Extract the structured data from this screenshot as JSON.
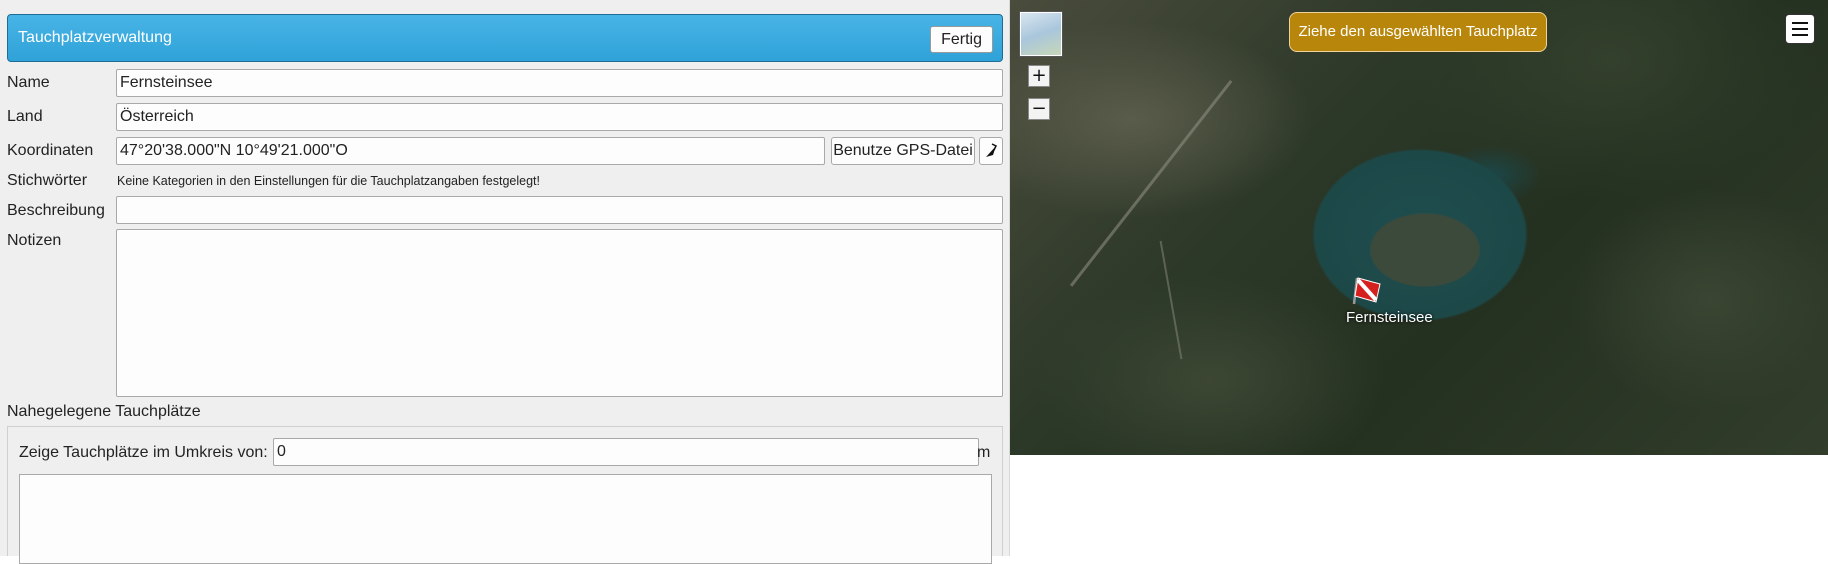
{
  "panel": {
    "title": "Tauchplatzverwaltung",
    "done_label": "Fertig"
  },
  "form": {
    "name": {
      "label": "Name",
      "value": "Fernsteinsee"
    },
    "country": {
      "label": "Land",
      "value": "Österreich"
    },
    "coordinates": {
      "label": "Koordinaten",
      "value": "47°20'38.000\"N 10°49'21.000\"O",
      "gps_button": "Benutze GPS-Datei"
    },
    "tags": {
      "label": "Stichwörter",
      "hint": "Keine Kategorien in den Einstellungen für die Tauchplatzangaben festgelegt!"
    },
    "description": {
      "label": "Beschreibung",
      "value": ""
    },
    "notes": {
      "label": "Notizen",
      "value": ""
    }
  },
  "nearby": {
    "title": "Nahegelegene Tauchplätze",
    "radius_label": "Zeige Tauchplätze im Umkreis von:",
    "radius_value": "0",
    "unit": "m"
  },
  "map": {
    "banner": "Ziehe den ausgewählten Tauchplatz",
    "marker_label": "Fernsteinsee",
    "zoom_in": "+",
    "zoom_out": "−",
    "icons": {
      "minimap": "map-thumbnail-icon",
      "menu": "hamburger-menu-icon",
      "gps": "gps-arrow-icon",
      "dive_flag": "dive-flag-icon"
    }
  },
  "colors": {
    "header_blue": "#3aaae0",
    "banner_gold": "#b8860b",
    "dive_flag_red": "#d62020"
  }
}
